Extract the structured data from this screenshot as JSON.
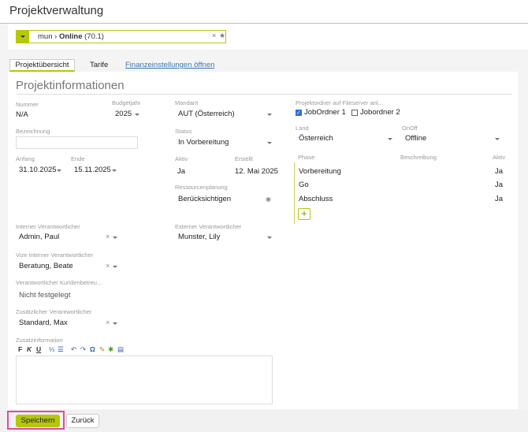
{
  "header": {
    "title": "Projektverwaltung"
  },
  "project_selector": {
    "prefix": "mun",
    "separator": "›",
    "name": "Online",
    "code": "(70.1)",
    "clear_icon": "×",
    "star_icon": "★"
  },
  "tabs": [
    {
      "label": "Projektübersicht"
    },
    {
      "label": "Tarife"
    },
    {
      "label": "Finanzeinstellungen öffnen"
    }
  ],
  "panel": {
    "title": "Projektinformationen",
    "nummer": {
      "label": "Nummer",
      "value": "N/A"
    },
    "budgetjahr": {
      "label": "Budgetjahr",
      "value": "2025"
    },
    "bezeichnung": {
      "label": "Bezeichnung",
      "value": ""
    },
    "anfang": {
      "label": "Anfang",
      "value": "31.10.2025"
    },
    "ende": {
      "label": "Ende",
      "value": "15.11.2025"
    },
    "mandant": {
      "label": "Mandant",
      "value": "AUT (Österreich)"
    },
    "status": {
      "label": "Status",
      "value": "In Vorbereitung"
    },
    "aktiv": {
      "label": "Aktiv",
      "value": "Ja"
    },
    "erstellt": {
      "label": "Erstellt",
      "value": "12. Mai 2025"
    },
    "ressourcenplanung": {
      "label": "Ressourcenplanung",
      "value": "Berücksichtigen"
    },
    "interner": {
      "label": "Interner Verantwortlicher",
      "value": "Admin, Paul"
    },
    "externer": {
      "label": "Externer Verantwortlicher",
      "value": "Munster, Lily"
    },
    "vize": {
      "label": "Vize Interner Verantwortlicher",
      "value": "Beratung, Beate"
    },
    "kundenbetreuer": {
      "label": "Verantwortlicher Kundenbetreu...",
      "value": "Nicht festgelegt"
    },
    "zusaetzlicher": {
      "label": "Zusätzlicher Verantwortlicher",
      "value": "Standard, Max"
    },
    "zusatzinformation": {
      "label": "Zusatzinformation"
    },
    "projektordner": {
      "label": "Projektordner auf Fileserver anl...",
      "options": [
        {
          "label": "JobOrdner 1",
          "checked": true
        },
        {
          "label": "Jobordner 2",
          "checked": false
        }
      ]
    },
    "land": {
      "label": "Land",
      "value": "Österreich"
    },
    "onoff": {
      "label": "OnOff",
      "value": "Offline"
    },
    "phases": {
      "headers": {
        "phase": "Phase",
        "beschreibung": "Beschreibung",
        "aktiv": "Aktiv"
      },
      "rows": [
        {
          "phase": "Vorbereitung",
          "aktiv": "Ja"
        },
        {
          "phase": "Go",
          "aktiv": "Ja"
        },
        {
          "phase": "Abschluss",
          "aktiv": "Ja"
        }
      ],
      "add_label": "+"
    }
  },
  "editor_toolbar": {
    "bold": "F",
    "italic": "K",
    "underline": "U",
    "ordered_list": "⅓",
    "bullet_list": "☰",
    "undo": "↶",
    "redo": "↷",
    "special_char": "Ω",
    "brush": "✎",
    "puzzle": "✱",
    "paste": "▤"
  },
  "footer": {
    "save_label": "Speichern",
    "back_label": "Zurück"
  },
  "colors": {
    "accent": "#b5c70c",
    "highlight": "#e14a9a",
    "link": "#3a78b8"
  }
}
